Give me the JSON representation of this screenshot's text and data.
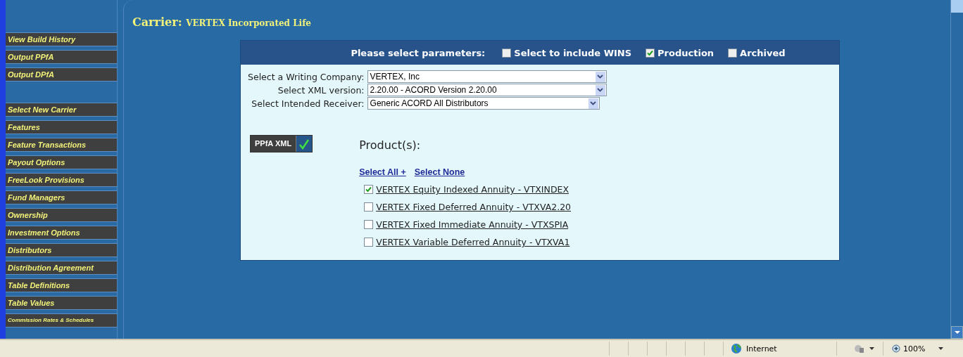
{
  "sidebar": {
    "groups": [
      [
        {
          "label": "View Build History"
        },
        {
          "label": "Output PPfA"
        },
        {
          "label": "Output DPfA"
        }
      ],
      [
        {
          "label": "Select New Carrier"
        },
        {
          "label": "Features"
        },
        {
          "label": "Feature Transactions"
        },
        {
          "label": "Payout Options"
        },
        {
          "label": "FreeLook Provisions"
        },
        {
          "label": "Fund Managers"
        },
        {
          "label": "Ownership"
        },
        {
          "label": "Investment Options"
        },
        {
          "label": "Distributors"
        },
        {
          "label": "Distribution Agreement"
        },
        {
          "label": "Table Definitions"
        },
        {
          "label": "Table Values"
        },
        {
          "label": "Commission Rates & Schedules",
          "kind": "small"
        }
      ]
    ]
  },
  "carrier": {
    "label": "Carrier:",
    "name": "VERTEX Incorporated Life"
  },
  "panel": {
    "title": "Please select parameters:",
    "options": [
      {
        "label": "Select to include WINS",
        "checked": false
      },
      {
        "label": "Production",
        "checked": true
      },
      {
        "label": "Archived",
        "checked": false
      }
    ],
    "fields": [
      {
        "label": "Select a Writing Company:",
        "value": "VERTEX, Inc"
      },
      {
        "label": "Select XML version:",
        "value": "2.20.00 - ACORD Version 2.20.00"
      },
      {
        "label": "Select Intended Receiver:",
        "value": "Generic ACORD All Distributors"
      }
    ],
    "output_button": {
      "label": "PPfA XML"
    },
    "products_heading": "Product(s):",
    "links": [
      "Select All +",
      "Select None"
    ],
    "products": [
      {
        "label": "VERTEX Equity Indexed Annuity - VTXINDEX",
        "checked": true
      },
      {
        "label": "VERTEX Fixed Deferred Annuity - VTXVA2.20",
        "checked": false
      },
      {
        "label": "VERTEX Fixed Immediate Annuity - VTXSPIA",
        "checked": false
      },
      {
        "label": "VERTEX Variable Deferred Annuity - VTXVA1",
        "checked": false
      }
    ]
  },
  "status_bar": {
    "zone": "Internet",
    "zoom": "100%"
  }
}
